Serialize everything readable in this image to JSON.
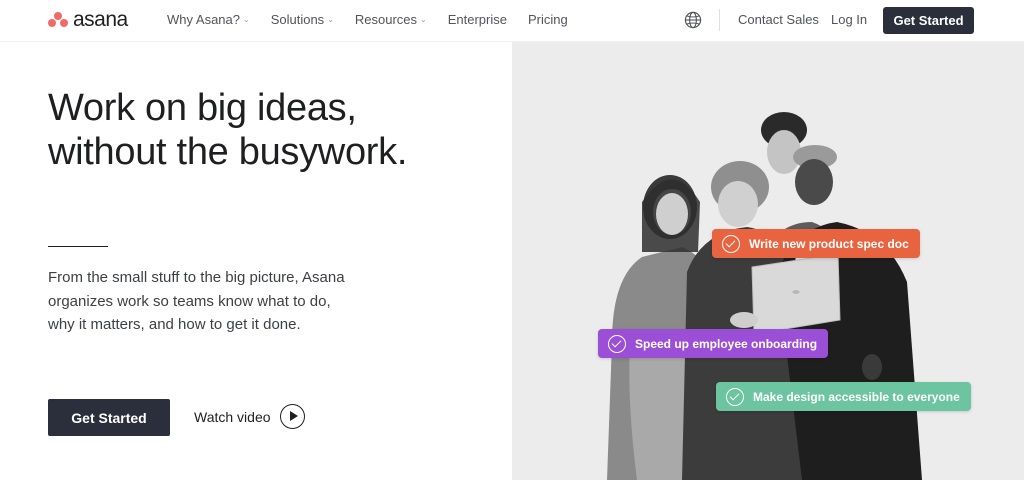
{
  "brand": {
    "name": "asana",
    "accent": "#f06a6a"
  },
  "nav": {
    "items": [
      {
        "label": "Why Asana?",
        "has_dropdown": true
      },
      {
        "label": "Solutions",
        "has_dropdown": true
      },
      {
        "label": "Resources",
        "has_dropdown": true
      },
      {
        "label": "Enterprise",
        "has_dropdown": false
      },
      {
        "label": "Pricing",
        "has_dropdown": false
      }
    ],
    "globe_icon": "globe-icon",
    "contact_sales": "Contact Sales",
    "log_in": "Log In",
    "get_started": "Get Started"
  },
  "hero": {
    "title_line1": "Work on big ideas,",
    "title_line2": "without the busywork.",
    "description": "From the small stuff to the big picture, Asana organizes work so teams know what to do, why it matters, and how to get it done.",
    "cta": "Get Started",
    "watch_video": "Watch video",
    "tasks": [
      {
        "label": "Write new product spec doc",
        "color": "#e8633f"
      },
      {
        "label": "Speed up employee onboarding",
        "color": "#9b4fd6"
      },
      {
        "label": "Make design accessible to everyone",
        "color": "#6cc4a0"
      }
    ]
  },
  "colors": {
    "dark_button": "#2b2f3b",
    "image_bg": "#ececec"
  }
}
